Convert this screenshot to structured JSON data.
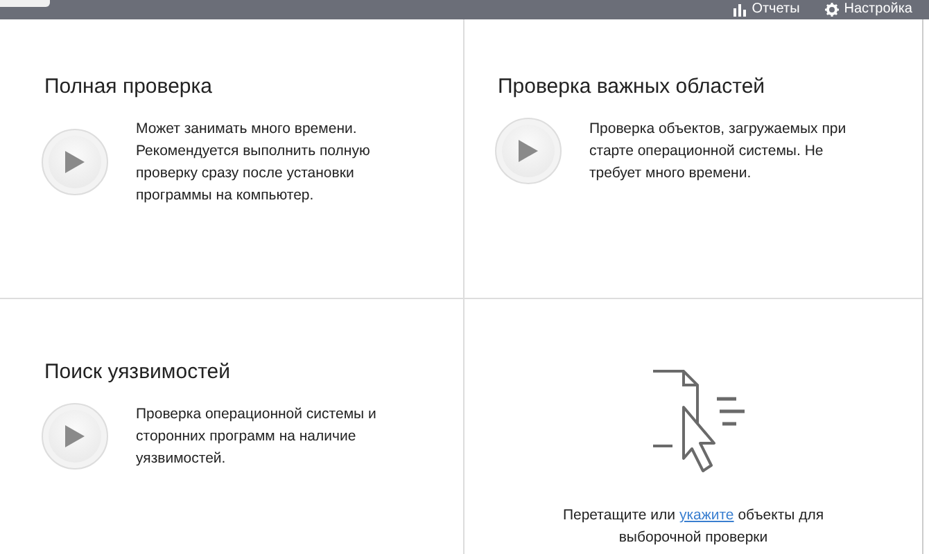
{
  "header": {
    "links": [
      {
        "kind": "reports",
        "label": "Отчеты"
      },
      {
        "kind": "settings",
        "label": "Настройка"
      }
    ]
  },
  "scans": [
    {
      "title": "Полная проверка",
      "description": "Может занимать много времени. Рекомендуется выполнить полную проверку сразу после установки программы на компьютер."
    },
    {
      "title": "Проверка важных областей",
      "description": "Проверка объектов, загружаемых при старте операционной системы. Не требует много времени."
    },
    {
      "title": "Поиск уязвимостей",
      "description": "Проверка операционной системы  и сторонних программ на наличие уязвимостей."
    }
  ],
  "drop_zone": {
    "text_before": "Перетащите или",
    "link": "укажите",
    "text_after": "объекты для выборочной проверки"
  }
}
